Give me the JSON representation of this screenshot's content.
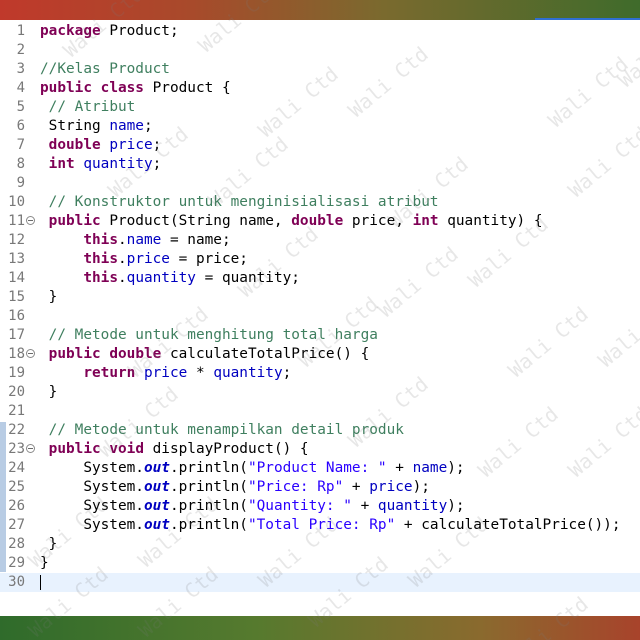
{
  "watermark_text": "Wali Ctd",
  "colors": {
    "keyword": "#7f0055",
    "comment": "#3f7f5f",
    "field": "#0000c0",
    "string": "#2a00ff",
    "line_number": "#787878",
    "current_line": "#e8f2fe"
  },
  "editor": {
    "current_line": 30,
    "lines": [
      {
        "n": "1",
        "fold": false,
        "tokens": [
          {
            "t": "kw",
            "v": "package"
          },
          {
            "t": "p",
            "v": " Product;"
          }
        ]
      },
      {
        "n": "2",
        "fold": false,
        "tokens": []
      },
      {
        "n": "3",
        "fold": false,
        "tokens": [
          {
            "t": "cm",
            "v": "//Kelas Product"
          }
        ]
      },
      {
        "n": "4",
        "fold": false,
        "tokens": [
          {
            "t": "kw",
            "v": "public"
          },
          {
            "t": "p",
            "v": " "
          },
          {
            "t": "kw",
            "v": "class"
          },
          {
            "t": "p",
            "v": " Product {"
          }
        ]
      },
      {
        "n": "5",
        "fold": false,
        "tokens": [
          {
            "t": "p",
            "v": " "
          },
          {
            "t": "cm",
            "v": "// Atribut"
          }
        ]
      },
      {
        "n": "6",
        "fold": false,
        "tokens": [
          {
            "t": "p",
            "v": " String "
          },
          {
            "t": "fd",
            "v": "name"
          },
          {
            "t": "p",
            "v": ";"
          }
        ]
      },
      {
        "n": "7",
        "fold": false,
        "tokens": [
          {
            "t": "p",
            "v": " "
          },
          {
            "t": "kw",
            "v": "double"
          },
          {
            "t": "p",
            "v": " "
          },
          {
            "t": "fd",
            "v": "price"
          },
          {
            "t": "p",
            "v": ";"
          }
        ]
      },
      {
        "n": "8",
        "fold": false,
        "tokens": [
          {
            "t": "p",
            "v": " "
          },
          {
            "t": "kw",
            "v": "int"
          },
          {
            "t": "p",
            "v": " "
          },
          {
            "t": "fd",
            "v": "quantity"
          },
          {
            "t": "p",
            "v": ";"
          }
        ]
      },
      {
        "n": "9",
        "fold": false,
        "tokens": []
      },
      {
        "n": "10",
        "fold": false,
        "tokens": [
          {
            "t": "p",
            "v": " "
          },
          {
            "t": "cm",
            "v": "// Konstruktor untuk menginisialisasi atribut"
          }
        ]
      },
      {
        "n": "11",
        "fold": true,
        "tokens": [
          {
            "t": "p",
            "v": " "
          },
          {
            "t": "kw",
            "v": "public"
          },
          {
            "t": "p",
            "v": " Product(String name, "
          },
          {
            "t": "kw",
            "v": "double"
          },
          {
            "t": "p",
            "v": " price, "
          },
          {
            "t": "kw",
            "v": "int"
          },
          {
            "t": "p",
            "v": " quantity) {"
          }
        ]
      },
      {
        "n": "12",
        "fold": false,
        "tokens": [
          {
            "t": "p",
            "v": "     "
          },
          {
            "t": "kw",
            "v": "this"
          },
          {
            "t": "p",
            "v": "."
          },
          {
            "t": "fd",
            "v": "name"
          },
          {
            "t": "p",
            "v": " = name;"
          }
        ]
      },
      {
        "n": "13",
        "fold": false,
        "tokens": [
          {
            "t": "p",
            "v": "     "
          },
          {
            "t": "kw",
            "v": "this"
          },
          {
            "t": "p",
            "v": "."
          },
          {
            "t": "fd",
            "v": "price"
          },
          {
            "t": "p",
            "v": " = price;"
          }
        ]
      },
      {
        "n": "14",
        "fold": false,
        "tokens": [
          {
            "t": "p",
            "v": "     "
          },
          {
            "t": "kw",
            "v": "this"
          },
          {
            "t": "p",
            "v": "."
          },
          {
            "t": "fd",
            "v": "quantity"
          },
          {
            "t": "p",
            "v": " = quantity;"
          }
        ]
      },
      {
        "n": "15",
        "fold": false,
        "tokens": [
          {
            "t": "p",
            "v": " }"
          }
        ]
      },
      {
        "n": "16",
        "fold": false,
        "tokens": []
      },
      {
        "n": "17",
        "fold": false,
        "tokens": [
          {
            "t": "p",
            "v": " "
          },
          {
            "t": "cm",
            "v": "// Metode untuk menghitung total harga"
          }
        ]
      },
      {
        "n": "18",
        "fold": true,
        "tokens": [
          {
            "t": "p",
            "v": " "
          },
          {
            "t": "kw",
            "v": "public"
          },
          {
            "t": "p",
            "v": " "
          },
          {
            "t": "kw",
            "v": "double"
          },
          {
            "t": "p",
            "v": " calculateTotalPrice() {"
          }
        ]
      },
      {
        "n": "19",
        "fold": false,
        "tokens": [
          {
            "t": "p",
            "v": "     "
          },
          {
            "t": "kw",
            "v": "return"
          },
          {
            "t": "p",
            "v": " "
          },
          {
            "t": "fd",
            "v": "price"
          },
          {
            "t": "p",
            "v": " * "
          },
          {
            "t": "fd",
            "v": "quantity"
          },
          {
            "t": "p",
            "v": ";"
          }
        ]
      },
      {
        "n": "20",
        "fold": false,
        "tokens": [
          {
            "t": "p",
            "v": " }"
          }
        ]
      },
      {
        "n": "21",
        "fold": false,
        "tokens": []
      },
      {
        "n": "22",
        "fold": false,
        "tokens": [
          {
            "t": "p",
            "v": " "
          },
          {
            "t": "cm",
            "v": "// Metode untuk menampilkan detail produk"
          }
        ]
      },
      {
        "n": "23",
        "fold": true,
        "tokens": [
          {
            "t": "p",
            "v": " "
          },
          {
            "t": "kw",
            "v": "public"
          },
          {
            "t": "p",
            "v": " "
          },
          {
            "t": "kw",
            "v": "void"
          },
          {
            "t": "p",
            "v": " displayProduct() {"
          }
        ]
      },
      {
        "n": "24",
        "fold": false,
        "tokens": [
          {
            "t": "p",
            "v": "     System."
          },
          {
            "t": "sf",
            "v": "out"
          },
          {
            "t": "p",
            "v": ".println("
          },
          {
            "t": "st",
            "v": "\"Product Name: \""
          },
          {
            "t": "p",
            "v": " + "
          },
          {
            "t": "fd",
            "v": "name"
          },
          {
            "t": "p",
            "v": ");"
          }
        ]
      },
      {
        "n": "25",
        "fold": false,
        "tokens": [
          {
            "t": "p",
            "v": "     System."
          },
          {
            "t": "sf",
            "v": "out"
          },
          {
            "t": "p",
            "v": ".println("
          },
          {
            "t": "st",
            "v": "\"Price: Rp\""
          },
          {
            "t": "p",
            "v": " + "
          },
          {
            "t": "fd",
            "v": "price"
          },
          {
            "t": "p",
            "v": ");"
          }
        ]
      },
      {
        "n": "26",
        "fold": false,
        "tokens": [
          {
            "t": "p",
            "v": "     System."
          },
          {
            "t": "sf",
            "v": "out"
          },
          {
            "t": "p",
            "v": ".println("
          },
          {
            "t": "st",
            "v": "\"Quantity: \""
          },
          {
            "t": "p",
            "v": " + "
          },
          {
            "t": "fd",
            "v": "quantity"
          },
          {
            "t": "p",
            "v": ");"
          }
        ]
      },
      {
        "n": "27",
        "fold": false,
        "tokens": [
          {
            "t": "p",
            "v": "     System."
          },
          {
            "t": "sf",
            "v": "out"
          },
          {
            "t": "p",
            "v": ".println("
          },
          {
            "t": "st",
            "v": "\"Total Price: Rp\""
          },
          {
            "t": "p",
            "v": " + calculateTotalPrice());"
          }
        ]
      },
      {
        "n": "28",
        "fold": false,
        "tokens": [
          {
            "t": "p",
            "v": " }"
          }
        ]
      },
      {
        "n": "29",
        "fold": false,
        "tokens": [
          {
            "t": "p",
            "v": "}"
          }
        ]
      },
      {
        "n": "30",
        "fold": false,
        "tokens": []
      }
    ]
  }
}
